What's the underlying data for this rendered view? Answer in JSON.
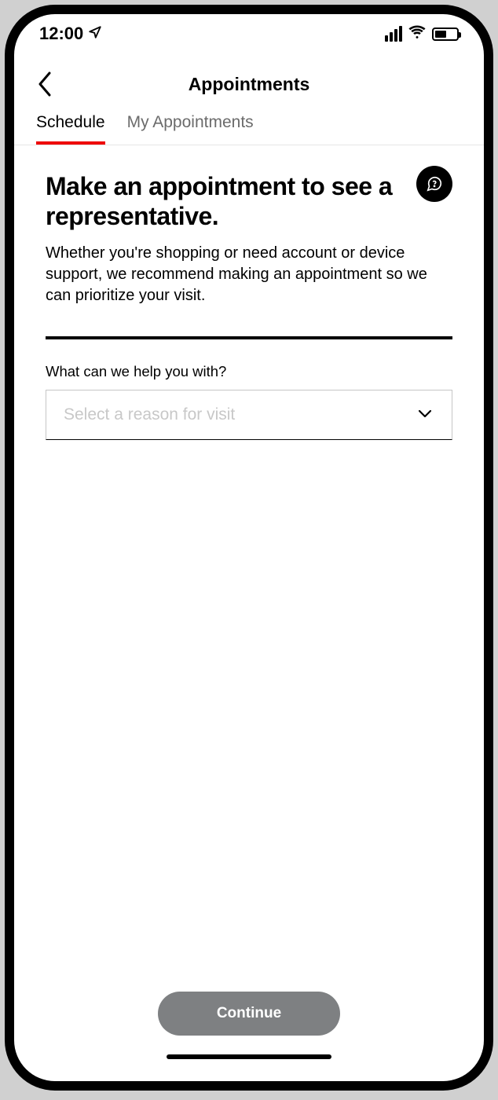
{
  "status": {
    "time": "12:00"
  },
  "nav": {
    "title": "Appointments"
  },
  "tabs": {
    "items": [
      {
        "label": "Schedule"
      },
      {
        "label": "My Appointments"
      }
    ]
  },
  "page": {
    "heading": "Make an appointment to see a representative.",
    "subtext": "Whether you're shopping or need account or device support, we recommend making an appointment so we can prioritize your visit.",
    "field_label": "What can we help you with?",
    "select_placeholder": "Select a reason for visit",
    "continue_label": "Continue"
  }
}
